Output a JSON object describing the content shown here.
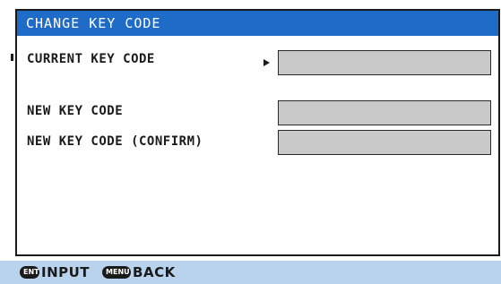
{
  "dialog": {
    "title": "CHANGE KEY CODE",
    "fields": [
      {
        "label": "CURRENT KEY CODE",
        "value": "",
        "selected": true
      },
      {
        "label": "NEW KEY CODE",
        "value": ""
      },
      {
        "label": "NEW KEY CODE (CONFIRM)",
        "value": ""
      }
    ]
  },
  "footer": {
    "ent_key": "ENT",
    "ent_action": "INPUT",
    "menu_key": "MENU",
    "menu_action": "BACK"
  },
  "colors": {
    "title_bar": "#1f6bc8",
    "footer_bg": "#b9d3ee",
    "field_bg": "#c9c9c9"
  },
  "icons": {
    "cursor": "cursor-arrow-icon",
    "ent": "ent-key-icon",
    "menu": "menu-key-icon"
  }
}
